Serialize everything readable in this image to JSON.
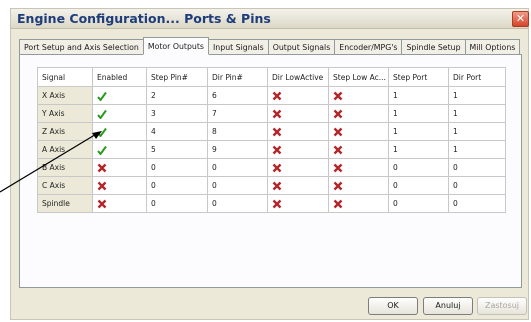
{
  "window": {
    "title": "Engine Configuration... Ports & Pins",
    "close": "✕"
  },
  "tabs": [
    {
      "label": "Port Setup and Axis Selection"
    },
    {
      "label": "Motor Outputs",
      "active": true
    },
    {
      "label": "Input Signals"
    },
    {
      "label": "Output Signals"
    },
    {
      "label": "Encoder/MPG's"
    },
    {
      "label": "Spindle Setup"
    },
    {
      "label": "Mill Options"
    }
  ],
  "table": {
    "columns": [
      "Signal",
      "Enabled",
      "Step Pin#",
      "Dir Pin#",
      "Dir LowActive",
      "Step Low Ac...",
      "Step Port",
      "Dir Port"
    ],
    "rows": [
      {
        "signal": "X Axis",
        "enabled": "check-icon",
        "step_pin": "2",
        "dir_pin": "6",
        "dir_low": "x-icon",
        "step_low": "x-icon",
        "step_port": "1",
        "dir_port": "1"
      },
      {
        "signal": "Y Axis",
        "enabled": "check-icon",
        "step_pin": "3",
        "dir_pin": "7",
        "dir_low": "x-icon",
        "step_low": "x-icon",
        "step_port": "1",
        "dir_port": "1"
      },
      {
        "signal": "Z Axis",
        "enabled": "check-icon",
        "step_pin": "4",
        "dir_pin": "8",
        "dir_low": "x-icon",
        "step_low": "x-icon",
        "step_port": "1",
        "dir_port": "1"
      },
      {
        "signal": "A Axis",
        "enabled": "check-icon",
        "step_pin": "5",
        "dir_pin": "9",
        "dir_low": "x-icon",
        "step_low": "x-icon",
        "step_port": "1",
        "dir_port": "1"
      },
      {
        "signal": "B Axis",
        "enabled": "x-icon",
        "step_pin": "0",
        "dir_pin": "0",
        "dir_low": "x-icon",
        "step_low": "x-icon",
        "step_port": "0",
        "dir_port": "0"
      },
      {
        "signal": "C Axis",
        "enabled": "x-icon",
        "step_pin": "0",
        "dir_pin": "0",
        "dir_low": "x-icon",
        "step_low": "x-icon",
        "step_port": "0",
        "dir_port": "0"
      },
      {
        "signal": "Spindle",
        "enabled": "x-icon",
        "step_pin": "0",
        "dir_pin": "0",
        "dir_low": "x-icon",
        "step_low": "x-icon",
        "step_port": "0",
        "dir_port": "0"
      }
    ]
  },
  "buttons": {
    "ok": "OK",
    "cancel": "Anuluj",
    "apply": "Zastosuj"
  },
  "colors": {
    "check": "#2a9a1c",
    "cross": "#b3262a",
    "title_text": "#1f3d7a"
  }
}
